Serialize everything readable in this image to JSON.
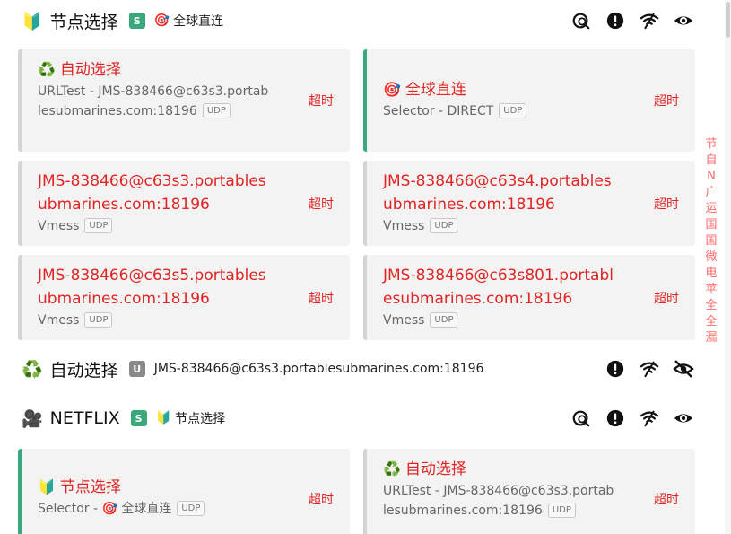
{
  "groups": [
    {
      "icon": "🔰",
      "title": "节点选择",
      "type_badge": "S",
      "now_icon": "🎯",
      "now": "全球直连",
      "actions": [
        "test-latency-icon",
        "alert-icon",
        "wifi-icon",
        "eye-icon"
      ]
    },
    {
      "icon": "♻️",
      "title": "自动选择",
      "type_badge": "U",
      "now": "JMS-838466@c63s3.portablesubmarines.com:18196",
      "actions": [
        "alert-icon",
        "wifi-icon",
        "eye-off-icon"
      ]
    },
    {
      "icon": "🎥",
      "title": "NETFLIX",
      "type_badge": "S",
      "now_icon": "🔰",
      "now": "节点选择",
      "actions": [
        "test-latency-icon",
        "alert-icon",
        "wifi-icon",
        "eye-icon"
      ]
    }
  ],
  "proxies_main": [
    {
      "icon": "♻️",
      "name": "自动选择",
      "meta": "URLTest - JMS-838466@c63s3.portablesubmarines.com:18196",
      "udp": "UDP",
      "delay": "超时",
      "selected": false
    },
    {
      "icon": "🎯",
      "name": "全球直连",
      "meta": "Selector - DIRECT",
      "udp": "UDP",
      "delay": "超时",
      "selected": true
    },
    {
      "name": "JMS-838466@c63s3.portablesubmarines.com:18196",
      "meta": "Vmess",
      "udp": "UDP",
      "delay": "超时",
      "selected": false
    },
    {
      "name": "JMS-838466@c63s4.portablesubmarines.com:18196",
      "meta": "Vmess",
      "udp": "UDP",
      "delay": "超时",
      "selected": false
    },
    {
      "name": "JMS-838466@c63s5.portablesubmarines.com:18196",
      "meta": "Vmess",
      "udp": "UDP",
      "delay": "超时",
      "selected": false
    },
    {
      "name": "JMS-838466@c63s801.portablesubmarines.com:18196",
      "meta": "Vmess",
      "udp": "UDP",
      "delay": "超时",
      "selected": false
    }
  ],
  "proxies_netflix": [
    {
      "icon": "🔰",
      "name": "节点选择",
      "meta_prefix": "Selector - ",
      "meta_icon": "🎯",
      "meta": "全球直连",
      "udp": "UDP",
      "delay": "超时",
      "selected": true
    },
    {
      "icon": "♻️",
      "name": "自动选择",
      "meta": "URLTest - JMS-838466@c63s3.portablesubmarines.com:18196",
      "udp": "UDP",
      "delay": "超时",
      "selected": false
    }
  ],
  "side_index": [
    "节",
    "自",
    "N",
    "广",
    "运",
    "国",
    "国",
    "微",
    "电",
    "苹",
    "全",
    "全",
    "漏"
  ],
  "colors": {
    "accent": "#3aa87c",
    "timeout": "#e02424",
    "card_bg": "#f3f3f3",
    "index": "#ff6b6b"
  }
}
